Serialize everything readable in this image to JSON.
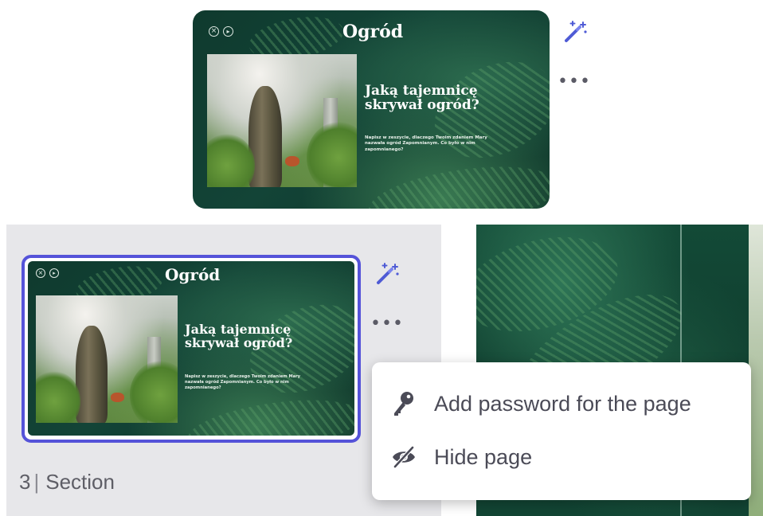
{
  "slide": {
    "title": "Ogród",
    "headline_line1": "Jaką tajemnicę",
    "headline_line2": "skrywał ogród?",
    "body": "Napisz w zeszycie, dlaczego Twoim zdaniem Mary nazwała ogród Zapomnianym. Co było w nim zapomnianego?",
    "control_close": "×",
    "control_play": "▸"
  },
  "section": {
    "number": "3",
    "separator": "|",
    "label": "Section"
  },
  "context_menu": {
    "add_password": "Add password for the page",
    "hide_page": "Hide page"
  },
  "toolbar": {
    "more_label": "•••"
  },
  "colors": {
    "selection": "#5553d9",
    "wand": "#4f5bd5",
    "menu_text": "#4b4b57"
  }
}
